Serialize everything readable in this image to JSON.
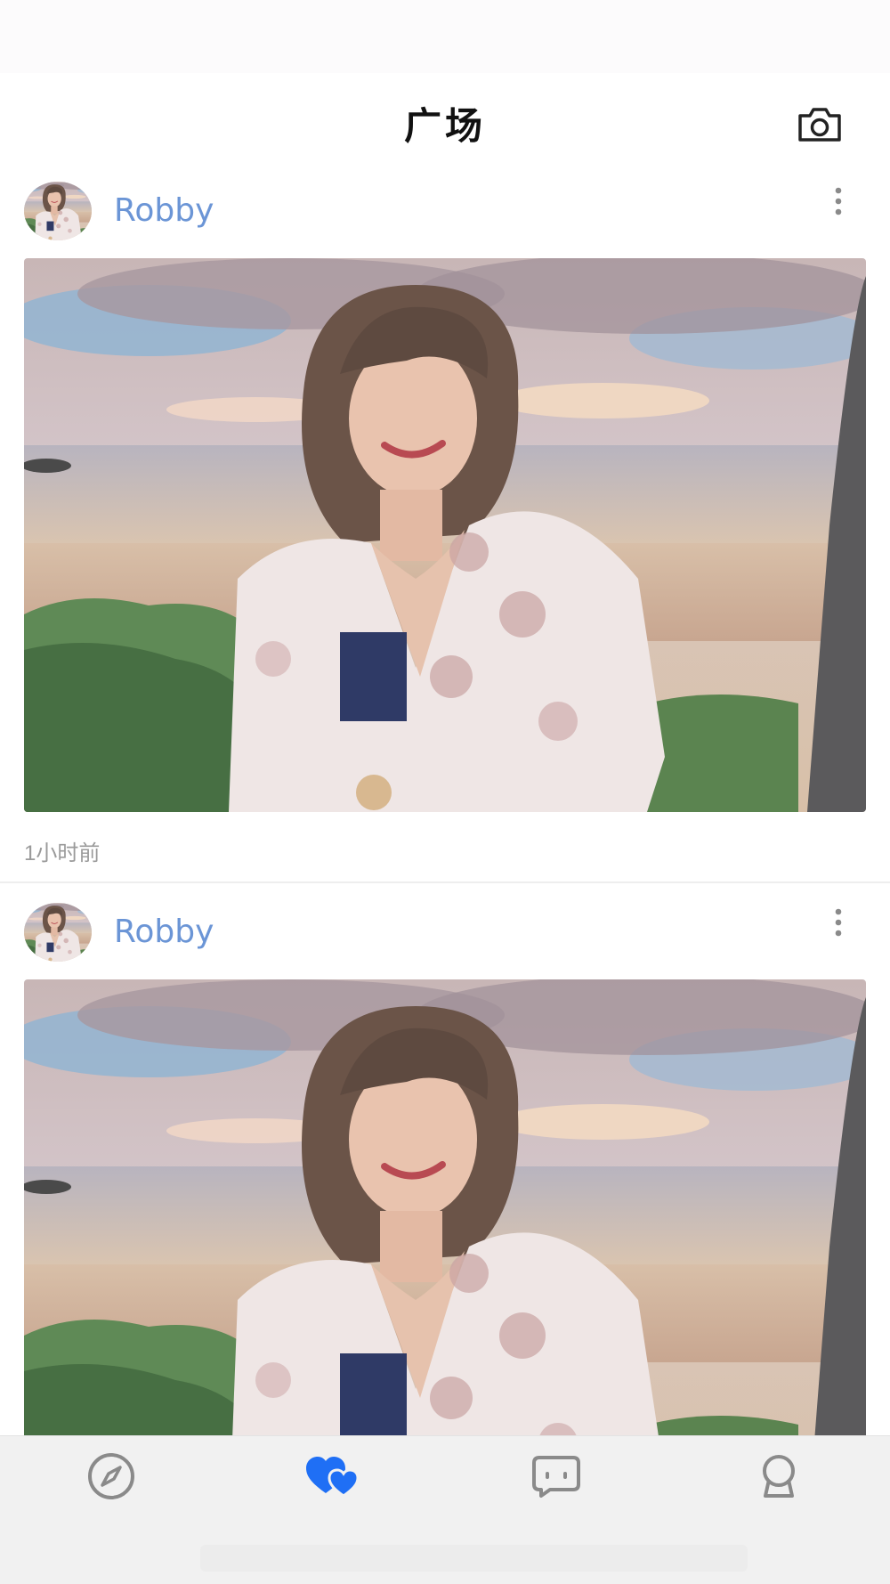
{
  "header": {
    "title": "广场",
    "camera_icon": "camera-icon"
  },
  "posts": [
    {
      "username": "Robby",
      "time": "1小时前",
      "avatar_icon": "avatar",
      "more_icon": "more-vertical-icon"
    },
    {
      "username": "Robby",
      "avatar_icon": "avatar",
      "more_icon": "more-vertical-icon"
    }
  ],
  "tabbar": {
    "tabs": [
      {
        "icon": "compass-icon",
        "active": false
      },
      {
        "icon": "hearts-icon",
        "active": true
      },
      {
        "icon": "chat-bubble-icon",
        "active": false
      },
      {
        "icon": "profile-icon",
        "active": false
      }
    ]
  },
  "colors": {
    "accent": "#1f6ff5",
    "username": "#6b95d6",
    "inactive_icon": "#8a8a8a",
    "tabbar_bg": "#f1f1f1"
  }
}
